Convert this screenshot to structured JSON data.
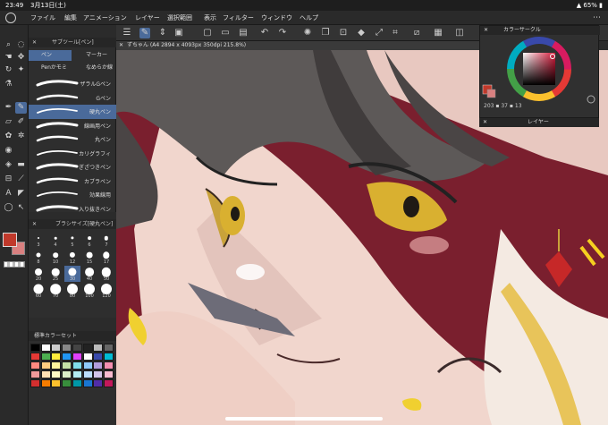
{
  "status": {
    "time": "23:49",
    "date": "3月13日(土)",
    "battery": "65%"
  },
  "menu": [
    "ファイル",
    "編集",
    "アニメーション",
    "レイヤー",
    "選択範囲",
    "表示",
    "フィルター",
    "ウィンドウ",
    "ヘルプ"
  ],
  "subtool": {
    "title": "サブツール[ペン]",
    "tabs": [
      "ペン",
      "マーカー",
      "Penかモミ",
      "なめらか線"
    ],
    "brushes": [
      "ザラルGペン",
      "Gペン",
      "硬丸ペン",
      "線画用ペン",
      "丸ペン",
      "カリグラフィ",
      "ぎざつきペン",
      "カブラペン",
      "効果線用",
      "入り抜きペン"
    ],
    "active_brush": "硬丸ペン"
  },
  "brushsize": {
    "title": "ブラシサイズ[硬丸ペン]",
    "sizes": [
      "3",
      "4",
      "5",
      "6",
      "7",
      "8",
      "10",
      "12",
      "15",
      "17",
      "20",
      "25",
      "30",
      "40",
      "50",
      "60",
      "70",
      "80",
      "100",
      "120"
    ],
    "active_size": "30"
  },
  "colorset": {
    "title": "標準カラーセット",
    "colors": [
      "#000000",
      "#ffffff",
      "#cccccc",
      "#888888",
      "#444444",
      "#222222",
      "#bbbbbb",
      "#666666",
      "#e53935",
      "#4caf50",
      "#ffeb3b",
      "#2196f3",
      "#e040fb",
      "#ffffff",
      "#3949ab",
      "#00bcd4",
      "#ff8a80",
      "#ffcc80",
      "#fff59d",
      "#c5e1a5",
      "#80deea",
      "#90caf9",
      "#b39ddb",
      "#f48fb1",
      "#ef9a9a",
      "#ffe0b2",
      "#fff9c4",
      "#dcedc8",
      "#b2ebf2",
      "#bbdefb",
      "#d1c4e9",
      "#f8bbd0",
      "#d32f2f",
      "#f57c00",
      "#fbc02d",
      "#388e3c",
      "#0097a7",
      "#1976d2",
      "#512da8",
      "#c2185b"
    ]
  },
  "canvas": {
    "title": "ずちゃん (A4 2894 x 4093px 350dpi 215.8%)"
  },
  "colorwheel": {
    "title": "カラーサークル",
    "h": "203",
    "s": "37",
    "v": "13"
  },
  "layer": {
    "title": "レイヤー"
  },
  "colors": {
    "main": "#c0392b",
    "sub": "#d98080",
    "accent": "#4a6a9a"
  }
}
